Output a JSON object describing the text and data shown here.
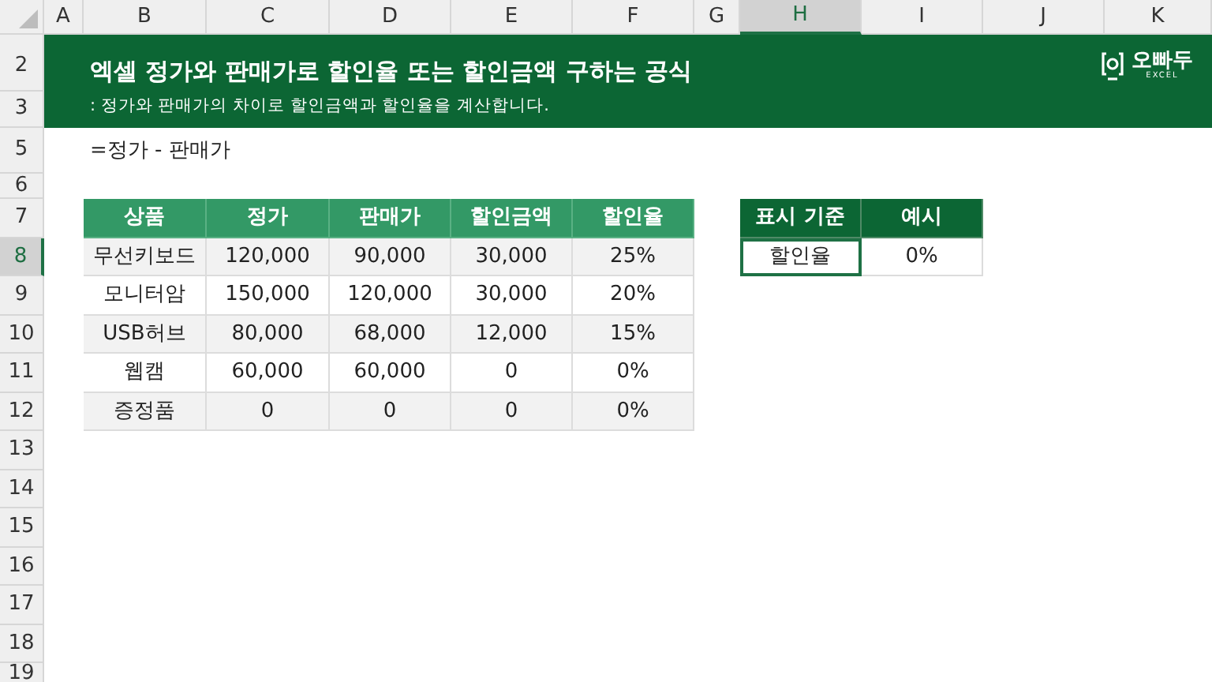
{
  "column_headers": [
    {
      "label": "A",
      "selected": false
    },
    {
      "label": "B",
      "selected": false
    },
    {
      "label": "C",
      "selected": false
    },
    {
      "label": "D",
      "selected": false
    },
    {
      "label": "E",
      "selected": false
    },
    {
      "label": "F",
      "selected": false
    },
    {
      "label": "G",
      "selected": false
    },
    {
      "label": "H",
      "selected": true
    },
    {
      "label": "I",
      "selected": false
    },
    {
      "label": "J",
      "selected": false
    },
    {
      "label": "K",
      "selected": false
    }
  ],
  "row_headers": [
    {
      "label": "2",
      "selected": false
    },
    {
      "label": "3",
      "selected": false
    },
    {
      "label": "5",
      "selected": false
    },
    {
      "label": "6",
      "selected": false
    },
    {
      "label": "7",
      "selected": false
    },
    {
      "label": "8",
      "selected": true
    },
    {
      "label": "9",
      "selected": false
    },
    {
      "label": "10",
      "selected": false
    },
    {
      "label": "11",
      "selected": false
    },
    {
      "label": "12",
      "selected": false
    },
    {
      "label": "13",
      "selected": false
    },
    {
      "label": "14",
      "selected": false
    },
    {
      "label": "15",
      "selected": false
    },
    {
      "label": "16",
      "selected": false
    },
    {
      "label": "17",
      "selected": false
    },
    {
      "label": "18",
      "selected": false
    },
    {
      "label": "19",
      "selected": false
    }
  ],
  "banner": {
    "title": "엑셀 정가와 판매가로 할인율 또는 할인금액 구하는 공식",
    "subtitle": ": 정가와 판매가의 차이로 할인금액과 할인율을 계산합니다.",
    "logo_text": "오빠두",
    "logo_tag": "EXCEL"
  },
  "formula_note": "=정가 - 판매가",
  "table": {
    "columns": [
      "상품",
      "정가",
      "판매가",
      "할인금액",
      "할인율"
    ],
    "rows": [
      [
        "무선키보드",
        "120,000",
        "90,000",
        "30,000",
        "25%"
      ],
      [
        "모니터암",
        "150,000",
        "120,000",
        "30,000",
        "20%"
      ],
      [
        "USB허브",
        "80,000",
        "68,000",
        "12,000",
        "15%"
      ],
      [
        "웹캠",
        "60,000",
        "60,000",
        "0",
        "0%"
      ],
      [
        "증정품",
        "0",
        "0",
        "0",
        "0%"
      ]
    ]
  },
  "display_table": {
    "columns": [
      "표시 기준",
      "예시"
    ],
    "rows": [
      [
        {
          "text": "할인율",
          "selected": true
        },
        {
          "text": "0%",
          "selected": false
        }
      ]
    ]
  }
}
